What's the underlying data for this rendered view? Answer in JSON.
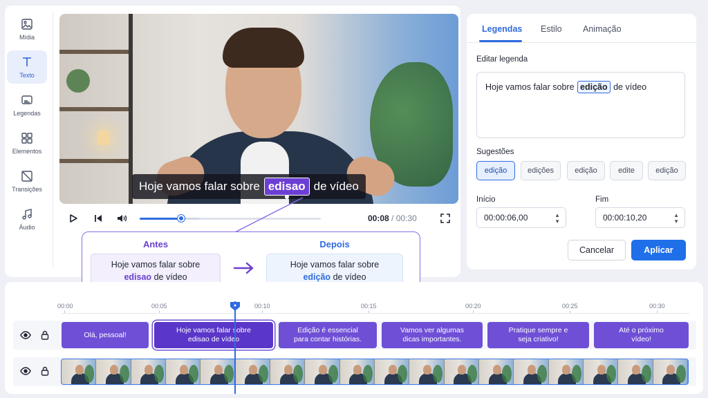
{
  "sidebar": {
    "items": [
      {
        "label": "Mídia",
        "icon": "image-icon"
      },
      {
        "label": "Texto",
        "icon": "text-icon"
      },
      {
        "label": "Legendas",
        "icon": "captions-icon"
      },
      {
        "label": "Elementos",
        "icon": "grid-icon"
      },
      {
        "label": "Transições",
        "icon": "transition-icon"
      },
      {
        "label": "Áudio",
        "icon": "music-icon"
      }
    ],
    "active": "Texto"
  },
  "video": {
    "caption_before": "Hoje vamos falar sobre",
    "caption_highlight": "edisao",
    "caption_after": "de vídeo"
  },
  "player": {
    "current_time": "00:08",
    "separator": "/",
    "total_time": "00:30",
    "progress": 0.23
  },
  "compare": {
    "before_title": "Antes",
    "before_line1": "Hoje vamos falar sobre",
    "before_word": "edisao",
    "before_rest": "de vídeo",
    "after_title": "Depois",
    "after_line1": "Hoje vamos falar sobre",
    "after_word": "edição",
    "after_rest": "de vídeo"
  },
  "panel": {
    "tabs": [
      "Legendas",
      "Estilo",
      "Animação"
    ],
    "active_tab": "Legendas",
    "edit_label": "Editar legenda",
    "edit_before": "Hoje vamos falar sobre",
    "edit_word": "edição",
    "edit_after": "de vídeo",
    "suggestions_label": "Sugestões",
    "suggestions": [
      "edição",
      "edições",
      "edição",
      "edite",
      "edição"
    ],
    "start_label": "Início",
    "start_value": "00:00:06,00",
    "end_label": "Fim",
    "end_value": "00:00:10,20",
    "cancel_label": "Cancelar",
    "apply_label": "Aplicar"
  },
  "timeline": {
    "ticks": [
      "00:00",
      "00:05",
      "00:10",
      "00:15",
      "00:20",
      "00:25",
      "00:30"
    ],
    "clips": [
      {
        "line1": "Olá, pessoal!",
        "line2": ""
      },
      {
        "line1": "Hoje vamos falar sobre",
        "line2": "edisao de vídeo"
      },
      {
        "line1": "Edição é essencial",
        "line2": "para contar histórias."
      },
      {
        "line1": "Vamos ver algumas",
        "line2": "dicas importantes."
      },
      {
        "line1": "Pratique sempre e",
        "line2": "seja criativo!"
      },
      {
        "line1": "Até o próximo",
        "line2": "vídeo!"
      }
    ],
    "selected_clip": 1
  },
  "colors": {
    "accent": "#2f6be0",
    "purple": "#6e4fd6",
    "apply": "#1f6fe8"
  }
}
